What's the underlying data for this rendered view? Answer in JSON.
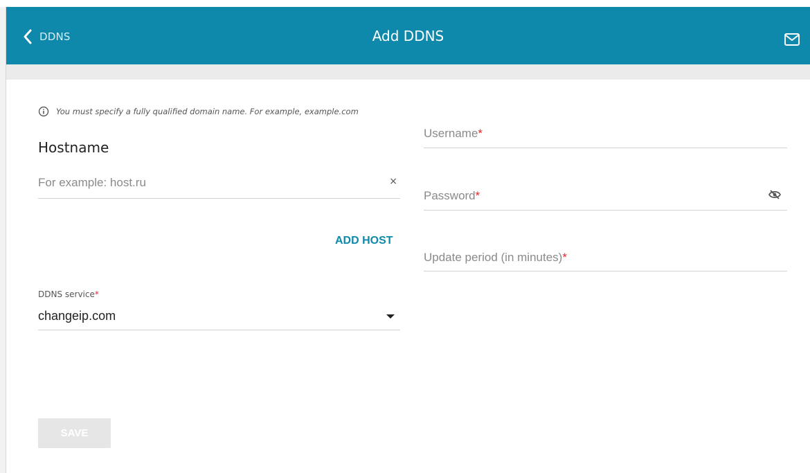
{
  "header": {
    "back_label": "DDNS",
    "title": "Add DDNS",
    "back_icon": "chevron-left-icon",
    "mail_icon": "mail-icon",
    "accent_color": "#0e88ab"
  },
  "form": {
    "info_text": "You must specify a fully qualified domain name. For example, example.com",
    "info_icon": "info-icon",
    "hostname_title": "Hostname",
    "hostname_placeholder": "For example: host.ru",
    "hostname_value": "",
    "clear_symbol": "×",
    "add_host_label": "ADD HOST",
    "ddns_service_label": "DDNS service",
    "ddns_service_value": "changeip.com",
    "required_mark": "*",
    "username_label": "Username",
    "password_label": "Password",
    "password_icon": "eye-off-icon",
    "update_period_label": "Update period (in minutes)",
    "save_label": "SAVE",
    "required_color": "#e3262b"
  }
}
